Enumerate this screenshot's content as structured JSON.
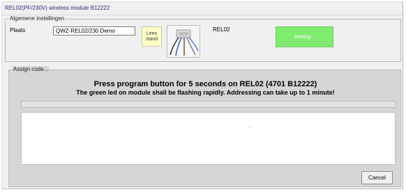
{
  "window": {
    "title": "REL02(PF/230V) wireless module B12222"
  },
  "settings": {
    "legend": "Algemene instellingen",
    "plaats_label": "Plaats",
    "plaats_value": "QWZ-REL02/230 Demo",
    "lees_button_line1": "Lees",
    "lees_button_line2": "stand",
    "module_label": "REL02",
    "status_label": "Waiting...",
    "status_color": "#7fec6f",
    "lees_color": "#ffffc8"
  },
  "assign": {
    "legend": "Assign code...",
    "instruction_line1": "Press program button for 5 seconds on REL02 (4701 B12222)",
    "instruction_line2": "The green led on module shall be flashing rapidly. Addressing can take up to 1 minute!",
    "progress": 0,
    "cancel_label": "Cancel"
  }
}
